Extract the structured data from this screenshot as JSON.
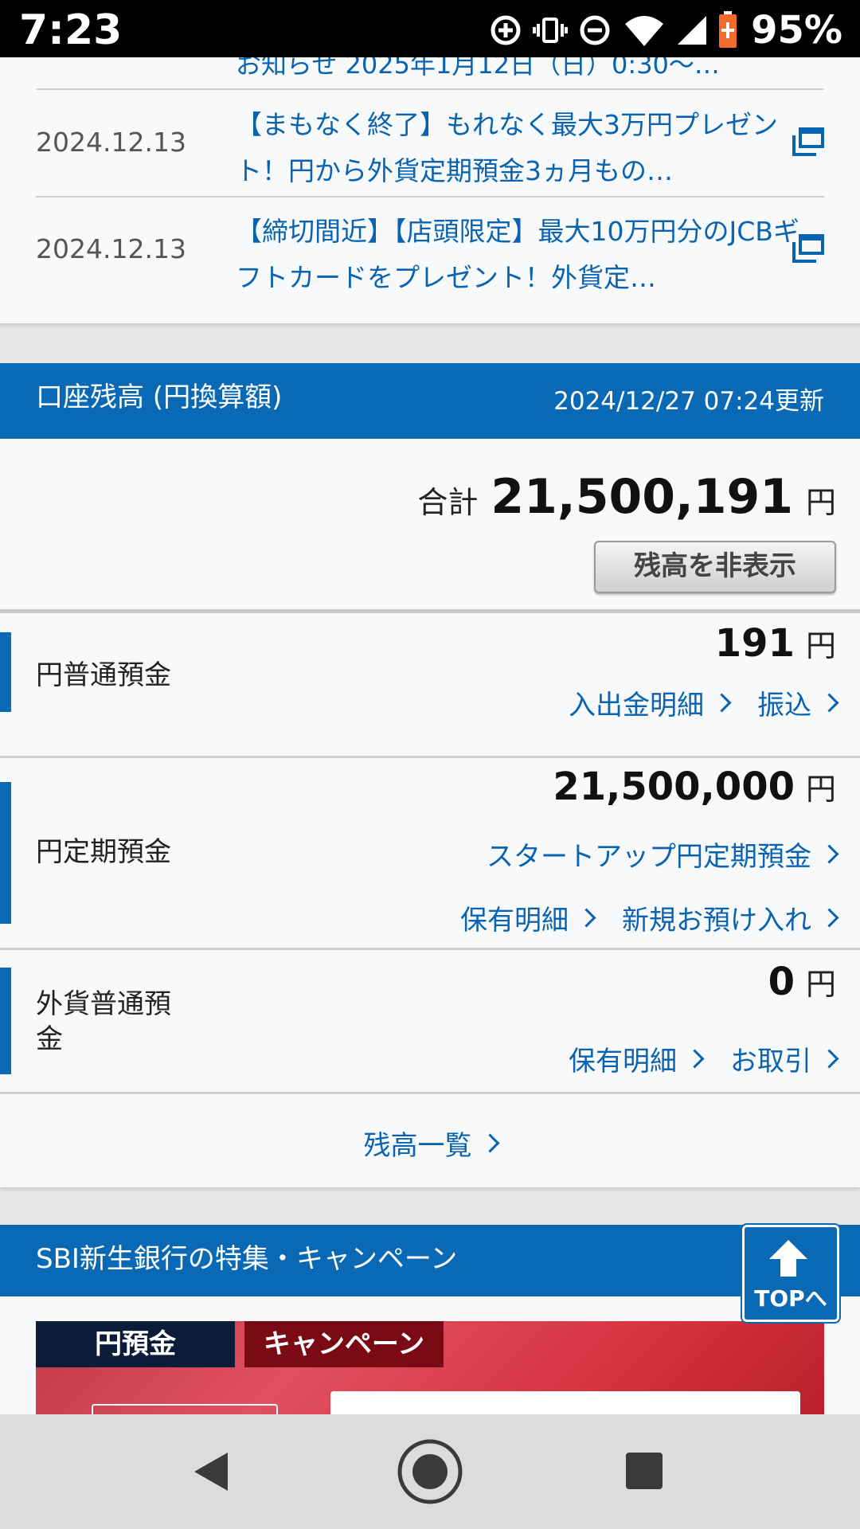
{
  "status_bar": {
    "time": "7:23",
    "battery_percent": "95%",
    "icons": [
      "data-saver-icon",
      "vibrate-icon",
      "do-not-disturb-icon",
      "wifi-icon",
      "cell-signal-icon",
      "battery-charging-icon"
    ]
  },
  "news": {
    "partial_title": "お知らせ 2025年1月12日（日）0:30～…",
    "items": [
      {
        "date": "2024.12.13",
        "title": "【まもなく終了】もれなく最大3万円プレゼント！円から外貨定期預金3ヵ月もの…",
        "icon": "external-window-icon"
      },
      {
        "date": "2024.12.13",
        "title": "【締切間近】【店頭限定】最大10万円分のJCBギフトカードをプレゼント！外貨定…",
        "icon": "external-window-icon"
      }
    ]
  },
  "balance": {
    "header_title": "口座残高 (円換算額)",
    "updated": "2024/12/27 07:24更新",
    "total_label": "合計",
    "total_amount": "21,500,191",
    "currency": "円",
    "hide_button": "残高を非表示",
    "accounts": [
      {
        "name": "円普通預金",
        "amount": "191",
        "currency": "円",
        "links": [
          "入出金明細",
          "振込"
        ]
      },
      {
        "name": "円定期預金",
        "amount": "21,500,000",
        "currency": "円",
        "links": [
          "スタートアップ円定期預金",
          "保有明細",
          "新規お預け入れ"
        ]
      },
      {
        "name_line1": "外貨普通預",
        "name_line2": "金",
        "amount": "0",
        "currency": "円",
        "links": [
          "保有明細",
          "お取引"
        ]
      }
    ],
    "list_link": "残高一覧"
  },
  "campaign": {
    "header_title": "SBI新生銀行の特集・キャンペーン",
    "tag1": "円預金",
    "tag2": "キャンペーン"
  },
  "top_button": {
    "label": "TOPへ",
    "icon": "arrow-up-icon"
  },
  "nav_bar": {
    "icons": [
      "back-icon",
      "home-icon",
      "recents-icon"
    ]
  },
  "colors": {
    "brand_blue": "#0a69b4",
    "link_blue": "#0a63b0",
    "campaign_red": "#d63342"
  }
}
